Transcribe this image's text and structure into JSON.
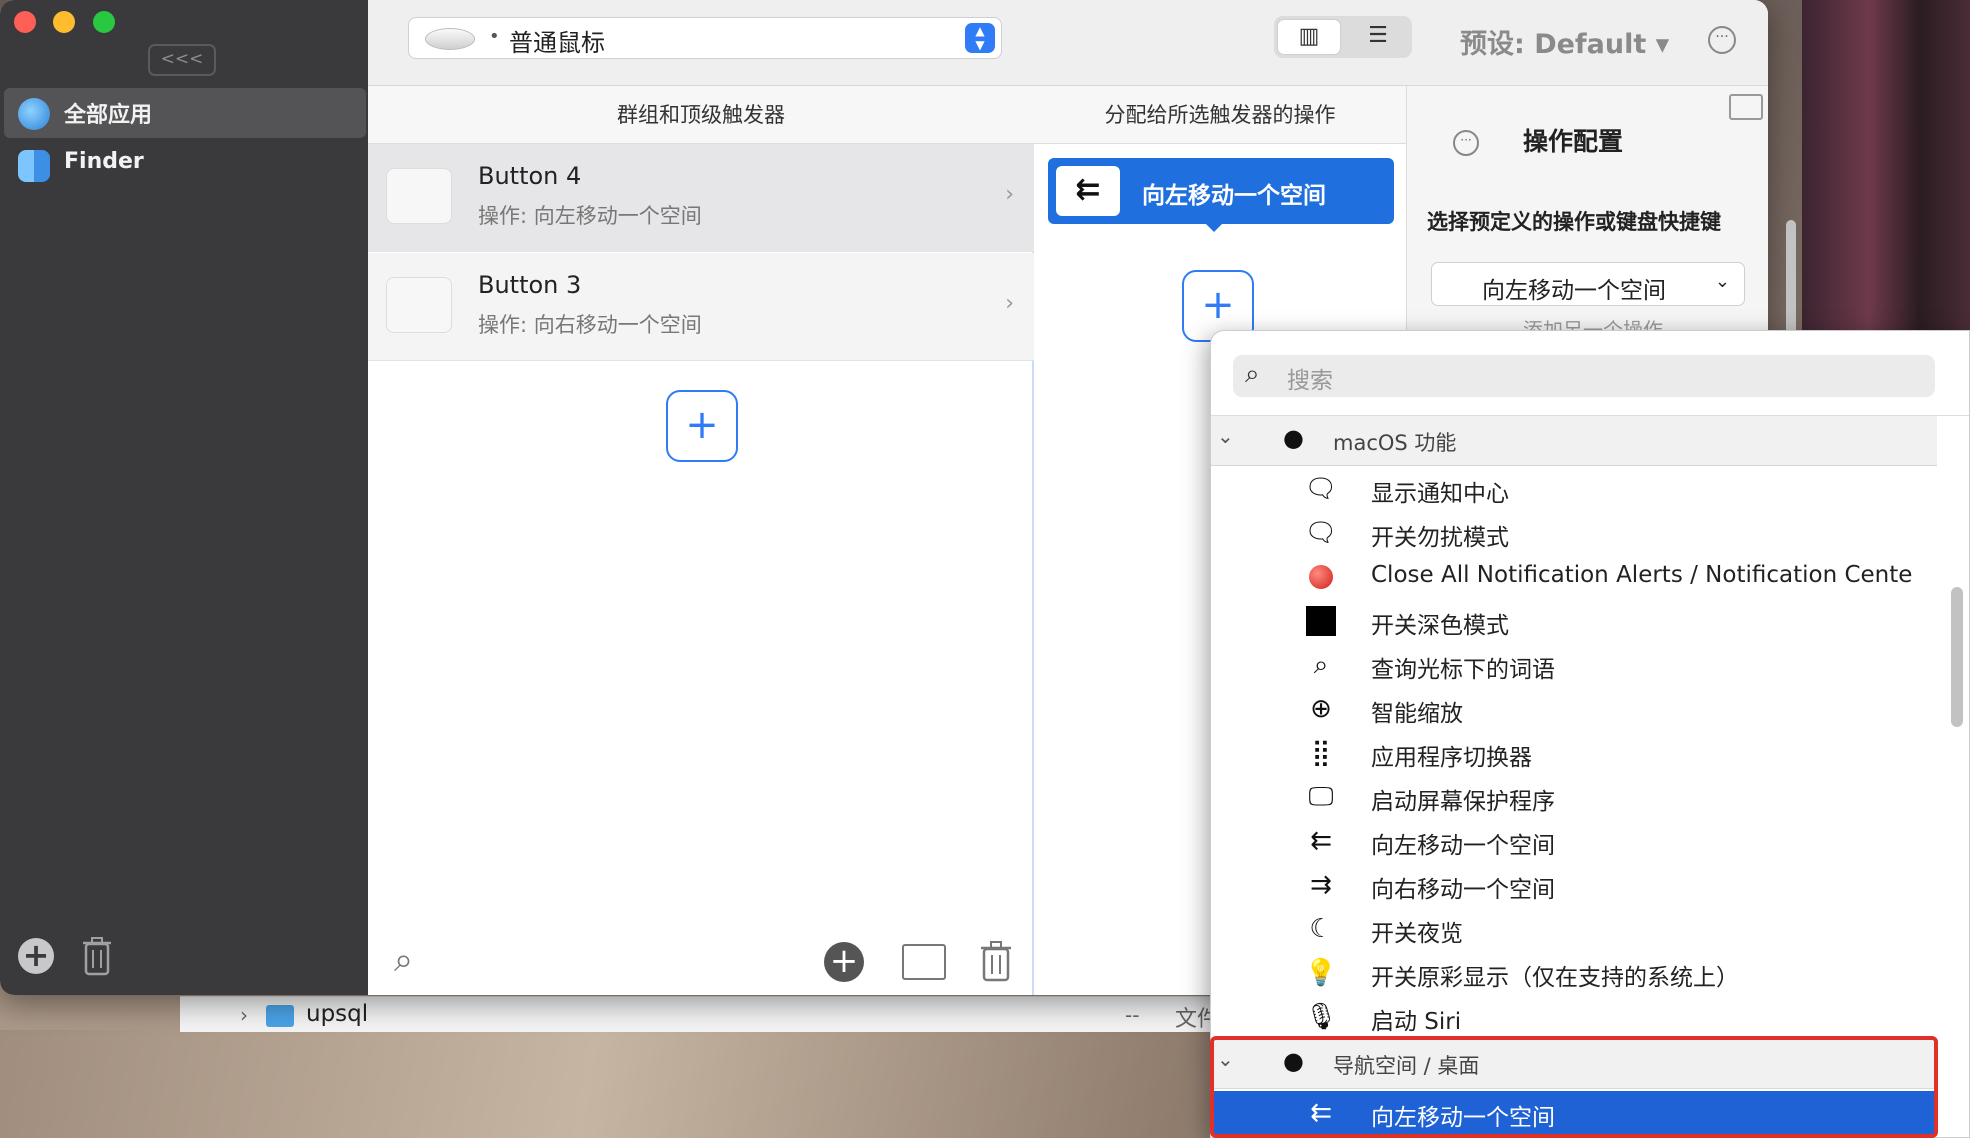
{
  "sidebar": {
    "collapse_label": "<<<",
    "items": [
      {
        "label": "全部应用",
        "icon": "globe-icon"
      },
      {
        "label": "Finder",
        "icon": "finder-icon"
      }
    ]
  },
  "toolbar": {
    "device_label": "普通鼠标",
    "preset_label": "预设: Default ▾"
  },
  "col1": {
    "header": "群组和顶级触发器",
    "rows": [
      {
        "title": "Button 4",
        "subtitle": "操作: 向左移动一个空间"
      },
      {
        "title": "Button 3",
        "subtitle": "操作: 向右移动一个空间"
      }
    ]
  },
  "col2": {
    "header": "分配给所选触发器的操作",
    "action_label": "向左移动一个空间"
  },
  "col3": {
    "title": "操作配置",
    "subtitle": "选择预定义的操作或键盘快捷键",
    "select_value": "向左移动一个空间",
    "hidden_text": "添加另一个操作"
  },
  "popup": {
    "search_placeholder": "搜索",
    "group1_label": "macOS 功能",
    "items": [
      "显示通知中心",
      "开关勿扰模式",
      "Close All Notification Alerts / Notification Cente",
      "开关深色模式",
      "查询光标下的词语",
      "智能缩放",
      "应用程序切换器",
      "启动屏幕保护程序",
      "向左移动一个空间",
      "向右移动一个空间",
      "开关夜览",
      "开关原彩显示（仅在支持的系统上）",
      "启动 Siri"
    ],
    "group2_label": "导航空间 / 桌面",
    "selected_item": "向左移动一个空间"
  },
  "finder": {
    "folder_name": "upsql",
    "dash": "--",
    "kind": "文件"
  },
  "colors": {
    "accent": "#1f6fde",
    "highlight": "#e0302a"
  }
}
